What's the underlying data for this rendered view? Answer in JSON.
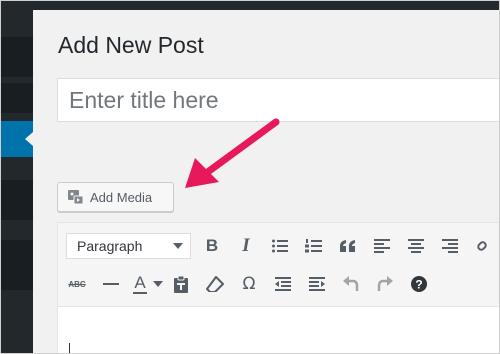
{
  "page": {
    "title": "Add New Post"
  },
  "title_field": {
    "value": "",
    "placeholder": "Enter title here"
  },
  "media": {
    "add_media_label": "Add Media"
  },
  "toolbar": {
    "format_select": {
      "selected": "Paragraph"
    },
    "color_letter": "A",
    "row1": [
      {
        "name": "bold-button",
        "icon": "bold-icon",
        "text": "B"
      },
      {
        "name": "italic-button",
        "icon": "italic-icon",
        "text": "I"
      },
      {
        "name": "bulleted-list-button",
        "icon": "bulleted-list-icon"
      },
      {
        "name": "numbered-list-button",
        "icon": "numbered-list-icon"
      },
      {
        "name": "blockquote-button",
        "icon": "quote-icon",
        "text": "“"
      },
      {
        "name": "align-left-button",
        "icon": "align-left-icon"
      },
      {
        "name": "align-center-button",
        "icon": "align-center-icon"
      },
      {
        "name": "align-right-button",
        "icon": "align-right-icon"
      }
    ],
    "row2": [
      {
        "name": "strikethrough-button",
        "icon": "strikethrough-icon",
        "text": "ABC"
      },
      {
        "name": "horizontal-line-button",
        "icon": "horizontal-line-icon"
      },
      {
        "name": "text-color-button",
        "icon": "text-color-icon"
      },
      {
        "name": "paste-as-text-button",
        "icon": "clipboard-icon"
      },
      {
        "name": "clear-formatting-button",
        "icon": "eraser-icon"
      },
      {
        "name": "special-character-button",
        "icon": "omega-icon",
        "text": "Ω"
      },
      {
        "name": "outdent-button",
        "icon": "outdent-icon"
      },
      {
        "name": "indent-button",
        "icon": "indent-icon"
      },
      {
        "name": "undo-button",
        "icon": "undo-icon"
      },
      {
        "name": "redo-button",
        "icon": "redo-icon"
      },
      {
        "name": "help-button",
        "icon": "help-icon",
        "text": "?"
      }
    ]
  },
  "colors": {
    "accent": "#0073aa",
    "admin_bar": "#23282d",
    "annotation_arrow": "#e8195a",
    "background": "#f1f1f1"
  }
}
